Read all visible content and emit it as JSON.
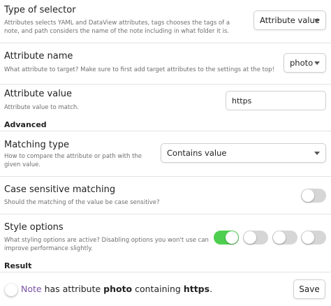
{
  "settings": {
    "selector_type": {
      "name": "Type of selector",
      "desc": "Attributes selects YAML and DataView attributes, tags chooses the tags of a note, and path considers the name of the note including in what folder it is.",
      "value": "Attribute value"
    },
    "attribute_name": {
      "name": "Attribute name",
      "desc": "What attribute to target? Make sure to first add target attributes to the settings at the top!",
      "value": "photo"
    },
    "attribute_value": {
      "name": "Attribute value",
      "desc": "Attribute value to match.",
      "value": "https"
    },
    "advanced_heading": "Advanced",
    "matching_type": {
      "name": "Matching type",
      "desc": "How to compare the attribute or path with the given value.",
      "value": "Contains value"
    },
    "case_sensitive": {
      "name": "Case sensitive matching",
      "desc": "Should the matching of the value be case sensitive?",
      "enabled": false
    },
    "style_options": {
      "name": "Style options",
      "desc": "What styling options are active? Disabling options you won't use can improve performance slightly.",
      "toggles": [
        true,
        false,
        false,
        false
      ]
    },
    "result_heading": "Result"
  },
  "result": {
    "note_word": "Note",
    "has_attribute": " has attribute ",
    "attribute": "photo",
    "containing": " containing ",
    "value": "https",
    "period": ".",
    "save_label": "Save"
  },
  "colors": {
    "toggle_on": "#4fcf4f",
    "toggle_off": "#d6d6d6",
    "note_link": "#7a52a6"
  }
}
